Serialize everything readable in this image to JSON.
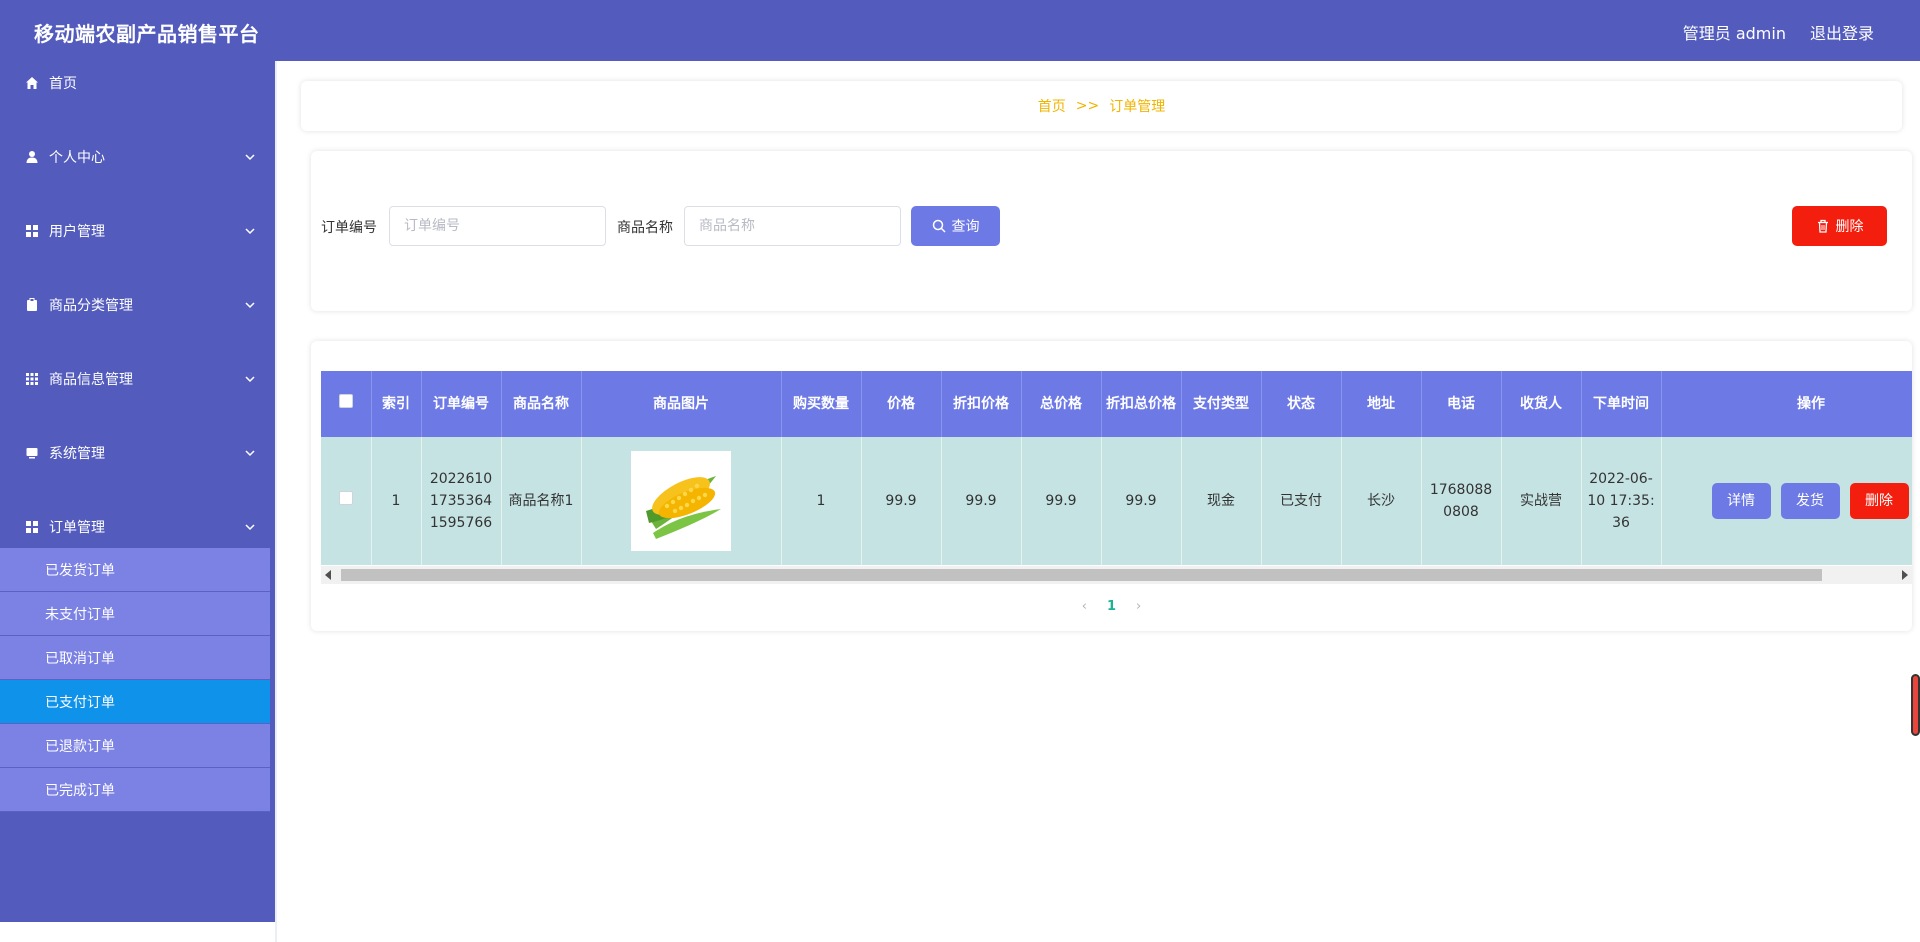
{
  "header": {
    "app_title": "移动端农副产品销售平台",
    "user_label": "管理员 admin",
    "logout_label": "退出登录"
  },
  "sidebar": {
    "items": [
      {
        "label": "首页",
        "icon": "home-icon"
      },
      {
        "label": "个人中心",
        "icon": "user-icon"
      },
      {
        "label": "用户管理",
        "icon": "grid-icon"
      },
      {
        "label": "商品分类管理",
        "icon": "clipboard-icon"
      },
      {
        "label": "商品信息管理",
        "icon": "apps-icon"
      },
      {
        "label": "系统管理",
        "icon": "monitor-icon"
      },
      {
        "label": "订单管理",
        "icon": "grid-icon"
      }
    ],
    "submenu": [
      {
        "label": "已发货订单"
      },
      {
        "label": "未支付订单"
      },
      {
        "label": "已取消订单"
      },
      {
        "label": "已支付订单",
        "active": true
      },
      {
        "label": "已退款订单"
      },
      {
        "label": "已完成订单"
      }
    ]
  },
  "breadcrumb": {
    "home": "首页",
    "separator": ">>",
    "current": "订单管理"
  },
  "search": {
    "order_no_label": "订单编号",
    "order_no_placeholder": "订单编号",
    "product_name_label": "商品名称",
    "product_name_placeholder": "商品名称",
    "query_label": "查询",
    "delete_label": "删除"
  },
  "table": {
    "columns": [
      "索引",
      "订单编号",
      "商品名称",
      "商品图片",
      "购买数量",
      "价格",
      "折扣价格",
      "总价格",
      "折扣总价格",
      "支付类型",
      "状态",
      "地址",
      "电话",
      "收货人",
      "下单时间",
      "操作"
    ],
    "rows": [
      {
        "index": "1",
        "order_no": "20226101735364159 5766",
        "order_no_display": "202261017353641595766",
        "product_name": "商品名称1",
        "image": "corn-image",
        "quantity": "1",
        "price": "99.9",
        "discount_price": "99.9",
        "total_price": "99.9",
        "discount_total": "99.9",
        "payment_type": "现金",
        "status": "已支付",
        "address": "长沙",
        "phone": "17680880808",
        "receiver": "实战营",
        "order_time": "2022-06-10 17:35:36",
        "actions": {
          "detail": "详情",
          "ship": "发货",
          "delete": "删除"
        }
      }
    ]
  },
  "pagination": {
    "current_page": "1"
  },
  "colors": {
    "header_bg": "#535bbd",
    "sidebar_bg": "#535bbd",
    "submenu_bg": "#7c82e4",
    "submenu_active": "#0f92ea",
    "table_header": "#6d7ae6",
    "row_bg": "#c6e3e4",
    "danger": "#f41e0e",
    "breadcrumb": "#f0b400"
  }
}
